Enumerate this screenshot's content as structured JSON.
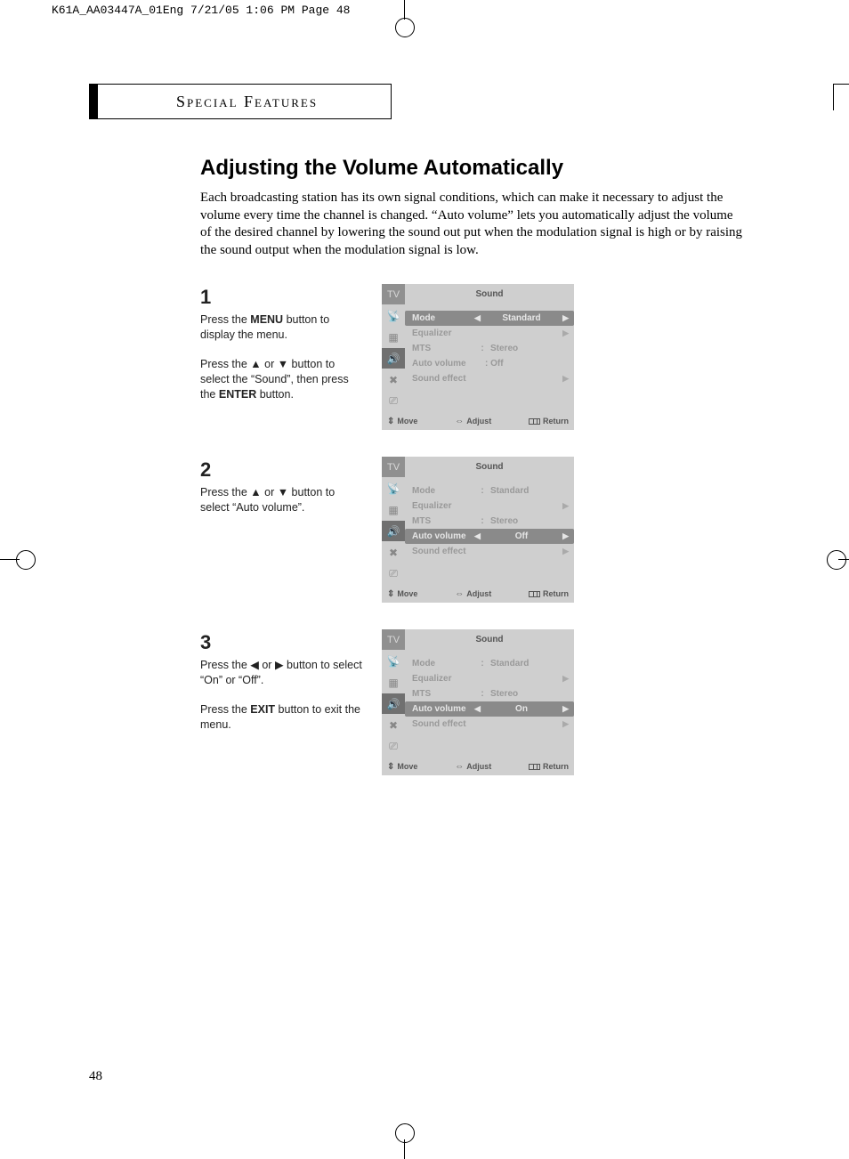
{
  "print_header": "K61A_AA03447A_01Eng  7/21/05  1:06 PM  Page 48",
  "section_header": "Special Features",
  "heading": "Adjusting the Volume Automatically",
  "intro": "Each broadcasting station has its own signal conditions, which can make it necessary to adjust the volume every time the channel is changed. “Auto volume” lets you automatically adjust the volume of the desired channel by lowering the sound out put when the modulation signal is high or by raising the sound output when the modulation signal is low.",
  "steps": [
    {
      "num": "1",
      "text_html": "Press the <b>MENU</b> button to display the menu.<br><br>Press the ▲ or ▼ button to select the “Sound”, then press the <b>ENTER</b> button."
    },
    {
      "num": "2",
      "text_html": "Press the ▲ or ▼ button to select “Auto volume”."
    },
    {
      "num": "3",
      "text_html": "Press the ◀ or ▶ button to select “On” or “Off”.<br><br>Press the <b>EXIT</b> button to exit the menu."
    }
  ],
  "osd": {
    "tv": "TV",
    "title": "Sound",
    "rows": {
      "mode": "Mode",
      "equalizer": "Equalizer",
      "mts": "MTS",
      "auto_volume": "Auto volume",
      "sound_effect": "Sound effect",
      "standard": "Standard",
      "stereo": "Stereo",
      "off": "Off",
      "off_colon": ": Off",
      "on": "On"
    },
    "footer": {
      "move": "Move",
      "adjust": "Adjust",
      "return": "Return"
    }
  },
  "page_num": "48"
}
